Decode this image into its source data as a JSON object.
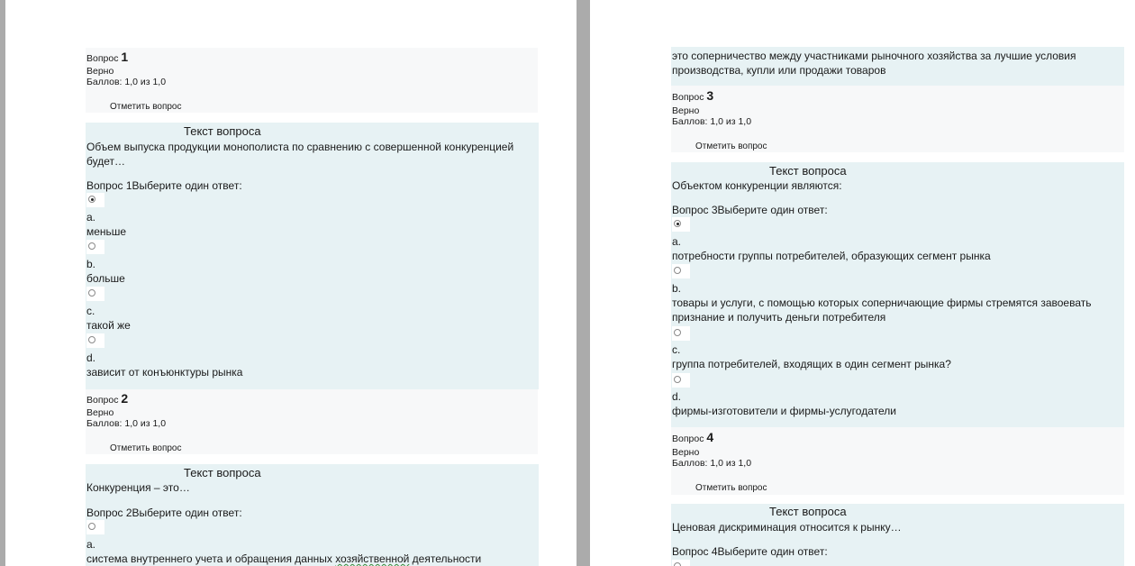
{
  "left_page": {
    "q1": {
      "label": "Вопрос",
      "number": "1",
      "status": "Верно",
      "score": "Баллов: 1,0 из 1,0",
      "flag": "Отметить вопрос",
      "text_heading": "Текст вопроса",
      "question_line1": "Объем выпуска продукции монополиста по сравнению с совершенной конкуренцией",
      "question_line2": "будет…",
      "prompt": "Вопрос 1Выберите один ответ:",
      "options": [
        {
          "letter": "a.",
          "text": "меньше",
          "selected": true
        },
        {
          "letter": "b.",
          "text": "больше",
          "selected": false
        },
        {
          "letter": "c.",
          "text": "такой же",
          "selected": false
        },
        {
          "letter": "d.",
          "text": "зависит от конъюнктуры рынка",
          "selected": false
        }
      ]
    },
    "q2": {
      "label": "Вопрос",
      "number": "2",
      "status": "Верно",
      "score": "Баллов: 1,0 из 1,0",
      "flag": "Отметить вопрос",
      "text_heading": "Текст вопроса",
      "question_line1": "Конкуренция – это…",
      "prompt": "Вопрос 2Выберите один ответ:",
      "option_a_letter": "a.",
      "option_a_text_pre": "система внутреннего учета и обращения данных ",
      "option_a_text_word": "хозяйственной",
      "option_a_text_post": " деятельности"
    }
  },
  "right_page": {
    "q2_cont": {
      "line1": "это соперничество между участниками рыночного хозяйства за лучшие условия",
      "line2": "производства, купли или продажи товаров"
    },
    "q3": {
      "label": "Вопрос",
      "number": "3",
      "status": "Верно",
      "score": "Баллов: 1,0 из 1,0",
      "flag": "Отметить вопрос",
      "text_heading": "Текст вопроса",
      "question_line1": "Объектом конкуренции являются:",
      "prompt": "Вопрос 3Выберите один ответ:",
      "options": [
        {
          "letter": "a.",
          "line1": "потребности группы потребителей, образующих сегмент рынка",
          "line2": "",
          "selected": true
        },
        {
          "letter": "b.",
          "line1": "товары и услуги, с помощью которых соперничающие фирмы стремятся завоевать",
          "line2": "признание и получить деньги потребителя",
          "selected": false
        },
        {
          "letter": "c.",
          "line1": "группа потребителей, входящих в один сегмент рынка?",
          "line2": "",
          "selected": false
        },
        {
          "letter": "d.",
          "line1": "фирмы-изготовители и фирмы-услугодатели",
          "line2": "",
          "selected": false
        }
      ]
    },
    "q4": {
      "label": "Вопрос",
      "number": "4",
      "status": "Верно",
      "score": "Баллов: 1,0 из 1,0",
      "flag": "Отметить вопрос",
      "text_heading": "Текст вопроса",
      "question_line1": "Ценовая дискриминация относится к рынку…",
      "prompt": "Вопрос 4Выберите один ответ:"
    }
  }
}
